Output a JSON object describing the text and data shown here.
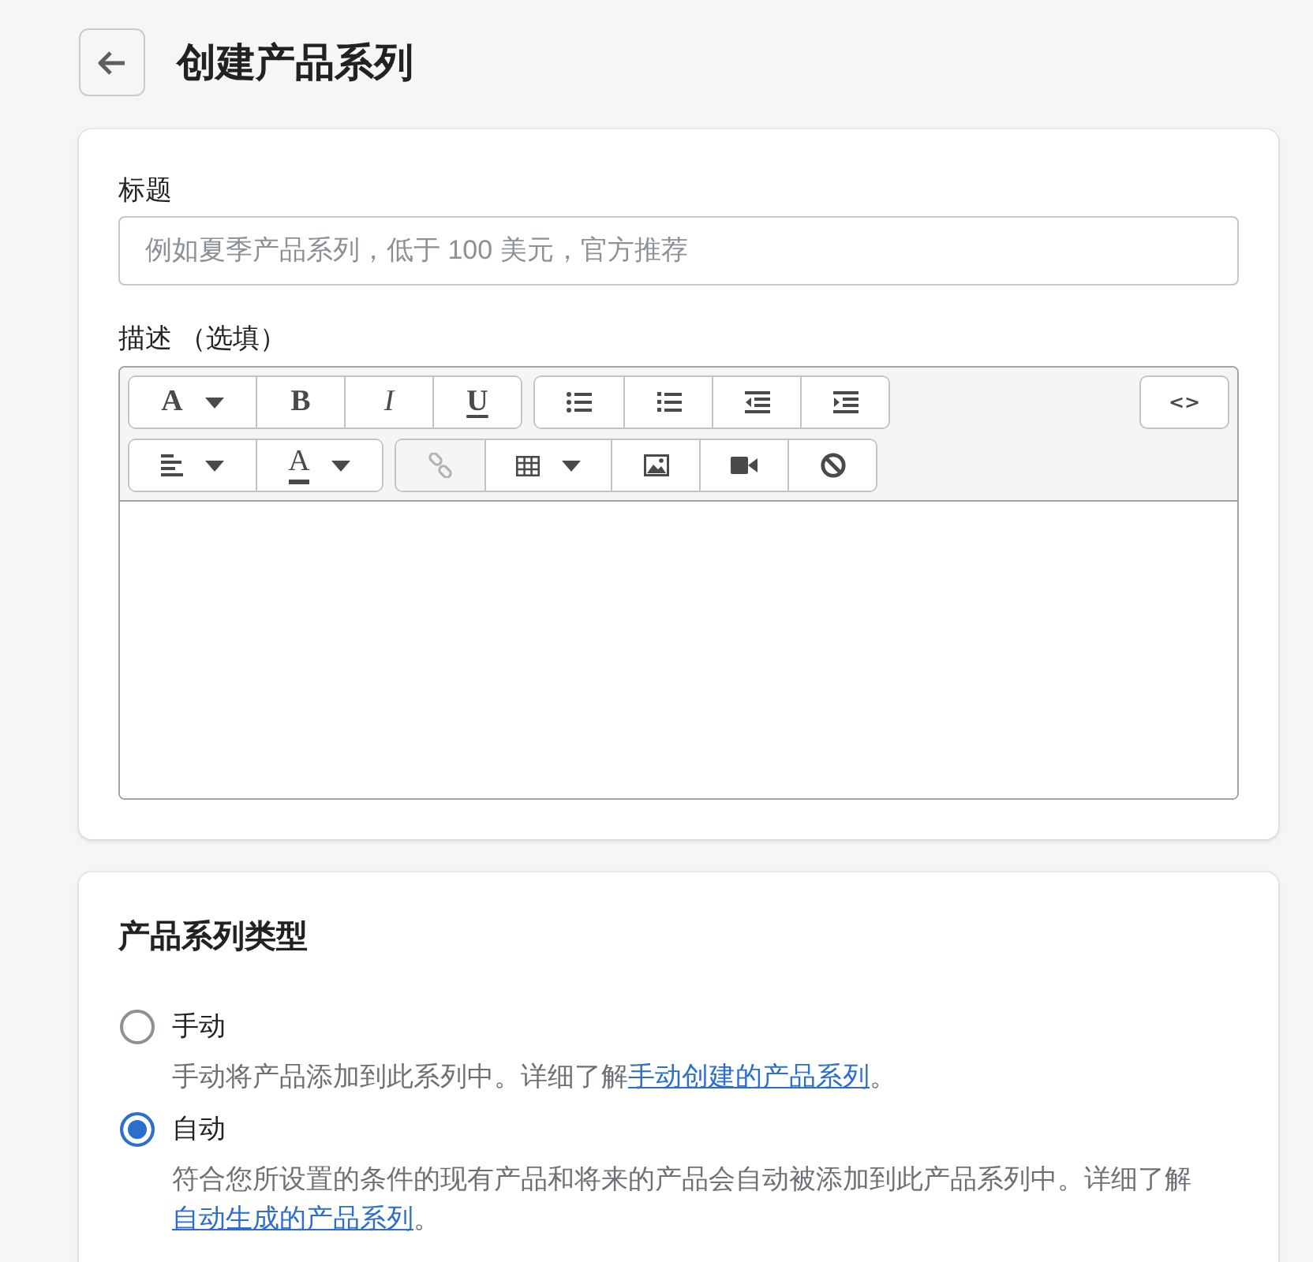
{
  "header": {
    "title": "创建产品系列"
  },
  "details": {
    "title_field": {
      "label": "标题",
      "placeholder": "例如夏季产品系列，低于 100 美元，官方推荐"
    },
    "description_field": {
      "label": "描述 （选填）",
      "toolbar": {
        "rows": [
          {
            "groups": [
              {
                "buttons": [
                  {
                    "kind": "format",
                    "label": "A",
                    "menu": true,
                    "disabled": false
                  },
                  {
                    "kind": "bold",
                    "label": "B",
                    "menu": false,
                    "disabled": false
                  },
                  {
                    "kind": "italic",
                    "label": "I",
                    "menu": false,
                    "disabled": false
                  },
                  {
                    "kind": "underline",
                    "label": "U",
                    "menu": false,
                    "disabled": false
                  }
                ]
              },
              {
                "buttons": [
                  {
                    "kind": "bullets",
                    "menu": false,
                    "disabled": false
                  },
                  {
                    "kind": "numbers",
                    "menu": false,
                    "disabled": false
                  },
                  {
                    "kind": "outdent",
                    "menu": false,
                    "disabled": false
                  },
                  {
                    "kind": "indent",
                    "menu": false,
                    "disabled": false
                  }
                ]
              }
            ]
          },
          {
            "groups": [
              {
                "buttons": [
                  {
                    "kind": "align",
                    "menu": true,
                    "disabled": false
                  },
                  {
                    "kind": "color",
                    "label": "A",
                    "menu": true,
                    "disabled": false
                  }
                ]
              },
              {
                "buttons": [
                  {
                    "kind": "link",
                    "menu": false,
                    "disabled": true
                  },
                  {
                    "kind": "table",
                    "menu": true,
                    "disabled": false
                  },
                  {
                    "kind": "image",
                    "menu": false,
                    "disabled": false
                  },
                  {
                    "kind": "video",
                    "menu": false,
                    "disabled": false
                  },
                  {
                    "kind": "clear",
                    "menu": false,
                    "disabled": false
                  }
                ]
              }
            ]
          }
        ],
        "source_button": {
          "label": "<>"
        }
      }
    }
  },
  "collection_type": {
    "heading": "产品系列类型",
    "options": [
      {
        "label": "手动",
        "selected": false,
        "description": {
          "text": "手动将产品添加到此系列中。详细了解",
          "link": "手动创建的产品系列",
          "end": "。"
        }
      },
      {
        "label": "自动",
        "selected": true,
        "description": {
          "text": "符合您所设置的条件的现有产品和将来的产品会自动被添加到此产品系列中。详细了解",
          "link": "自动生成的产品系列",
          "end": "。"
        }
      }
    ]
  }
}
